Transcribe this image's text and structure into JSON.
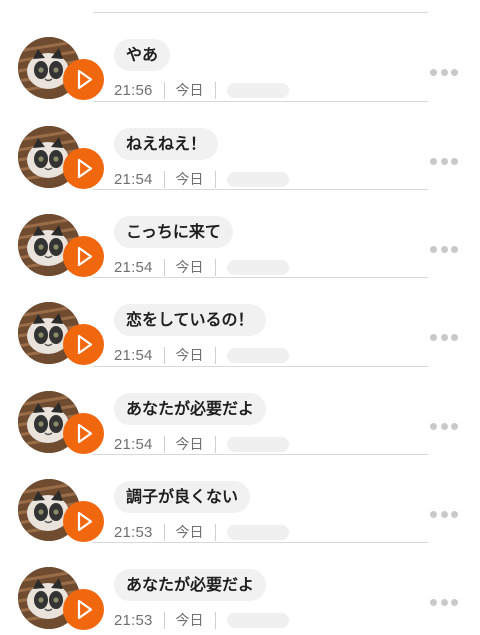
{
  "colors": {
    "play_button": "#f0670e",
    "bubble_bg": "#f1f1f1",
    "divider": "#d8d8d8",
    "meta_text": "#707070"
  },
  "icons": {
    "avatar": "cat-photo-avatar",
    "play": "play-icon",
    "more": "more-options-icon"
  },
  "messages": [
    {
      "text": "やあ",
      "time": "21:56",
      "day": "今日"
    },
    {
      "text": "ねえねえ！",
      "time": "21:54",
      "day": "今日"
    },
    {
      "text": "こっちに来て",
      "time": "21:54",
      "day": "今日"
    },
    {
      "text": "恋をしているの！",
      "time": "21:54",
      "day": "今日"
    },
    {
      "text": "あなたが必要だよ",
      "time": "21:54",
      "day": "今日"
    },
    {
      "text": "調子が良くない",
      "time": "21:53",
      "day": "今日"
    },
    {
      "text": "あなたが必要だよ",
      "time": "21:53",
      "day": "今日"
    }
  ]
}
